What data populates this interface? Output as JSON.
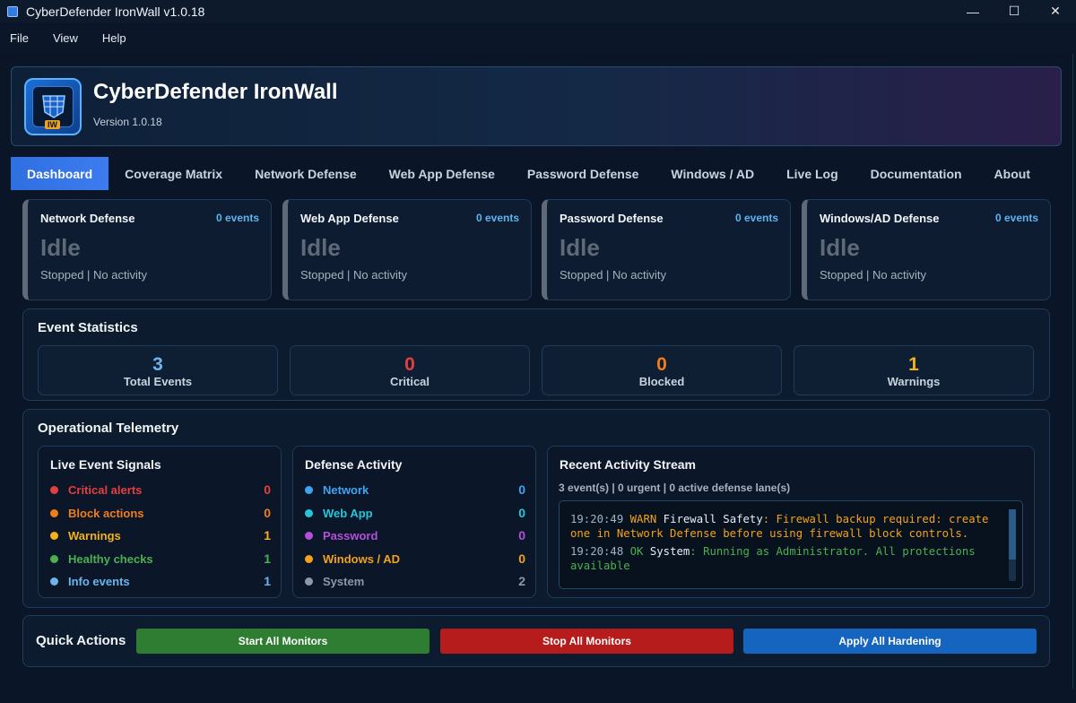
{
  "window": {
    "title": "CyberDefender IronWall v1.0.18",
    "minimize": "—",
    "maximize": "☐",
    "close": "✕"
  },
  "menu": [
    "File",
    "View",
    "Help"
  ],
  "header": {
    "title": "CyberDefender IronWall",
    "version": "Version 1.0.18",
    "logo_badge": "IW"
  },
  "tabs": [
    "Dashboard",
    "Coverage Matrix",
    "Network Defense",
    "Web App Defense",
    "Password Defense",
    "Windows / AD",
    "Live Log",
    "Documentation",
    "About"
  ],
  "active_tab": "Dashboard",
  "cards": [
    {
      "title": "Network Defense",
      "events": "0 events",
      "state": "Idle",
      "detail": "Stopped | No activity"
    },
    {
      "title": "Web App Defense",
      "events": "0 events",
      "state": "Idle",
      "detail": "Stopped | No activity"
    },
    {
      "title": "Password Defense",
      "events": "0 events",
      "state": "Idle",
      "detail": "Stopped | No activity"
    },
    {
      "title": "Windows/AD Defense",
      "events": "0 events",
      "state": "Idle",
      "detail": "Stopped | No activity"
    }
  ],
  "event_statistics": {
    "title": "Event Statistics",
    "items": [
      {
        "value": "3",
        "label": "Total Events",
        "color": "#6cb4ea"
      },
      {
        "value": "0",
        "label": "Critical",
        "color": "#e53e3e"
      },
      {
        "value": "0",
        "label": "Blocked",
        "color": "#f07c1a"
      },
      {
        "value": "1",
        "label": "Warnings",
        "color": "#f2b21b"
      }
    ]
  },
  "telemetry": {
    "title": "Operational Telemetry",
    "signals": {
      "title": "Live Event Signals",
      "rows": [
        {
          "label": "Critical alerts",
          "value": "0",
          "color": "#e53e3e"
        },
        {
          "label": "Block actions",
          "value": "0",
          "color": "#f07c1a"
        },
        {
          "label": "Warnings",
          "value": "1",
          "color": "#f2b21b"
        },
        {
          "label": "Healthy checks",
          "value": "1",
          "color": "#4caf50"
        },
        {
          "label": "Info events",
          "value": "1",
          "color": "#6cb4ea"
        }
      ]
    },
    "activity": {
      "title": "Defense Activity",
      "rows": [
        {
          "label": "Network",
          "value": "0",
          "color": "#3fa4f0"
        },
        {
          "label": "Web App",
          "value": "0",
          "color": "#26c6da"
        },
        {
          "label": "Password",
          "value": "0",
          "color": "#b44fd8"
        },
        {
          "label": "Windows / AD",
          "value": "0",
          "color": "#f2a21b"
        },
        {
          "label": "System",
          "value": "2",
          "color": "#8d99a6"
        }
      ]
    },
    "stream": {
      "title": "Recent Activity Stream",
      "summary": "3 event(s) | 0 urgent | 0 active defense lane(s)",
      "log": [
        {
          "time": "19:20:49",
          "level": "WARN",
          "source": "Firewall Safety",
          "message": ": Firewall backup required: create one in Network Defense before using firewall block controls.",
          "level_color": "#f2a21b",
          "msg_color": "#f2a21b"
        },
        {
          "time": "19:20:48",
          "level": "OK",
          "source": "System",
          "message": ": Running as Administrator. All protections available",
          "level_color": "#4caf50",
          "msg_color": "#4caf50"
        }
      ]
    }
  },
  "quick_actions": {
    "title": "Quick Actions",
    "buttons": [
      {
        "label": "Start All Monitors",
        "color": "#2e7d32"
      },
      {
        "label": "Stop All Monitors",
        "color": "#b71c1c"
      },
      {
        "label": "Apply All Hardening",
        "color": "#1565c0"
      }
    ]
  }
}
